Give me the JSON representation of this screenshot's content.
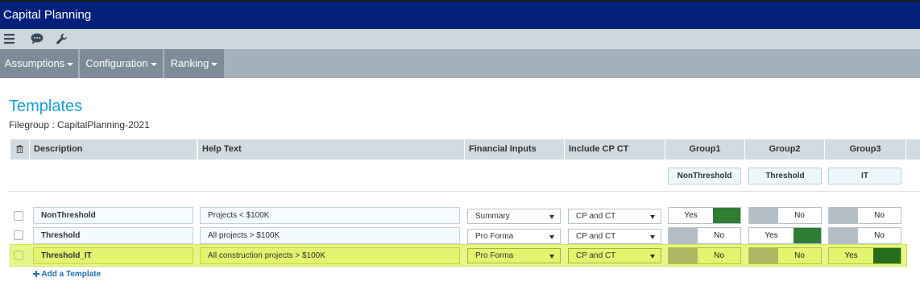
{
  "app": {
    "title": "Capital Planning"
  },
  "toolbar": {
    "icons": [
      "menu-icon",
      "comment-icon",
      "wrench-icon"
    ]
  },
  "menu": {
    "assumptions": "Assumptions",
    "configuration": "Configuration",
    "ranking": "Ranking"
  },
  "page": {
    "title": "Templates",
    "subtitle": "Filegroup : CapitalPlanning-2021"
  },
  "table": {
    "headers": {
      "description": "Description",
      "help_text": "Help Text",
      "financial_inputs": "Financial Inputs",
      "include_cp_ct": "Include CP CT",
      "group1": "Group1",
      "group2": "Group2",
      "group3": "Group3"
    },
    "group_labels": [
      "NonThreshold",
      "Threshold",
      "IT"
    ],
    "rows": [
      {
        "description": "NonThreshold",
        "help_text": "Projects < $100K",
        "financial_inputs": "Summary",
        "include_cp_ct": "CP and CT",
        "groups": [
          "Yes",
          "No",
          "No"
        ],
        "highlighted": false
      },
      {
        "description": "Threshold",
        "help_text": "All projects > $100K",
        "financial_inputs": "Pro Forma",
        "include_cp_ct": "CP and CT",
        "groups": [
          "No",
          "Yes",
          "No"
        ],
        "highlighted": false
      },
      {
        "description": "Threshold_IT",
        "help_text": "All construction projects > $100K",
        "financial_inputs": "Pro Forma",
        "include_cp_ct": "CP and CT",
        "groups": [
          "No",
          "No",
          "Yes"
        ],
        "highlighted": true
      }
    ],
    "add_label": "Add a Template"
  },
  "colors": {
    "titlebar": "#04217a",
    "accent_title": "#1a9ed2",
    "toggle_on": "#2e7d32",
    "toggle_off": "#b3bec6",
    "toggle_on_highlight": "#256d1d",
    "toggle_off_highlight": "#adb764",
    "row_highlight": "#e7f68a",
    "link": "#1f6fb0"
  }
}
